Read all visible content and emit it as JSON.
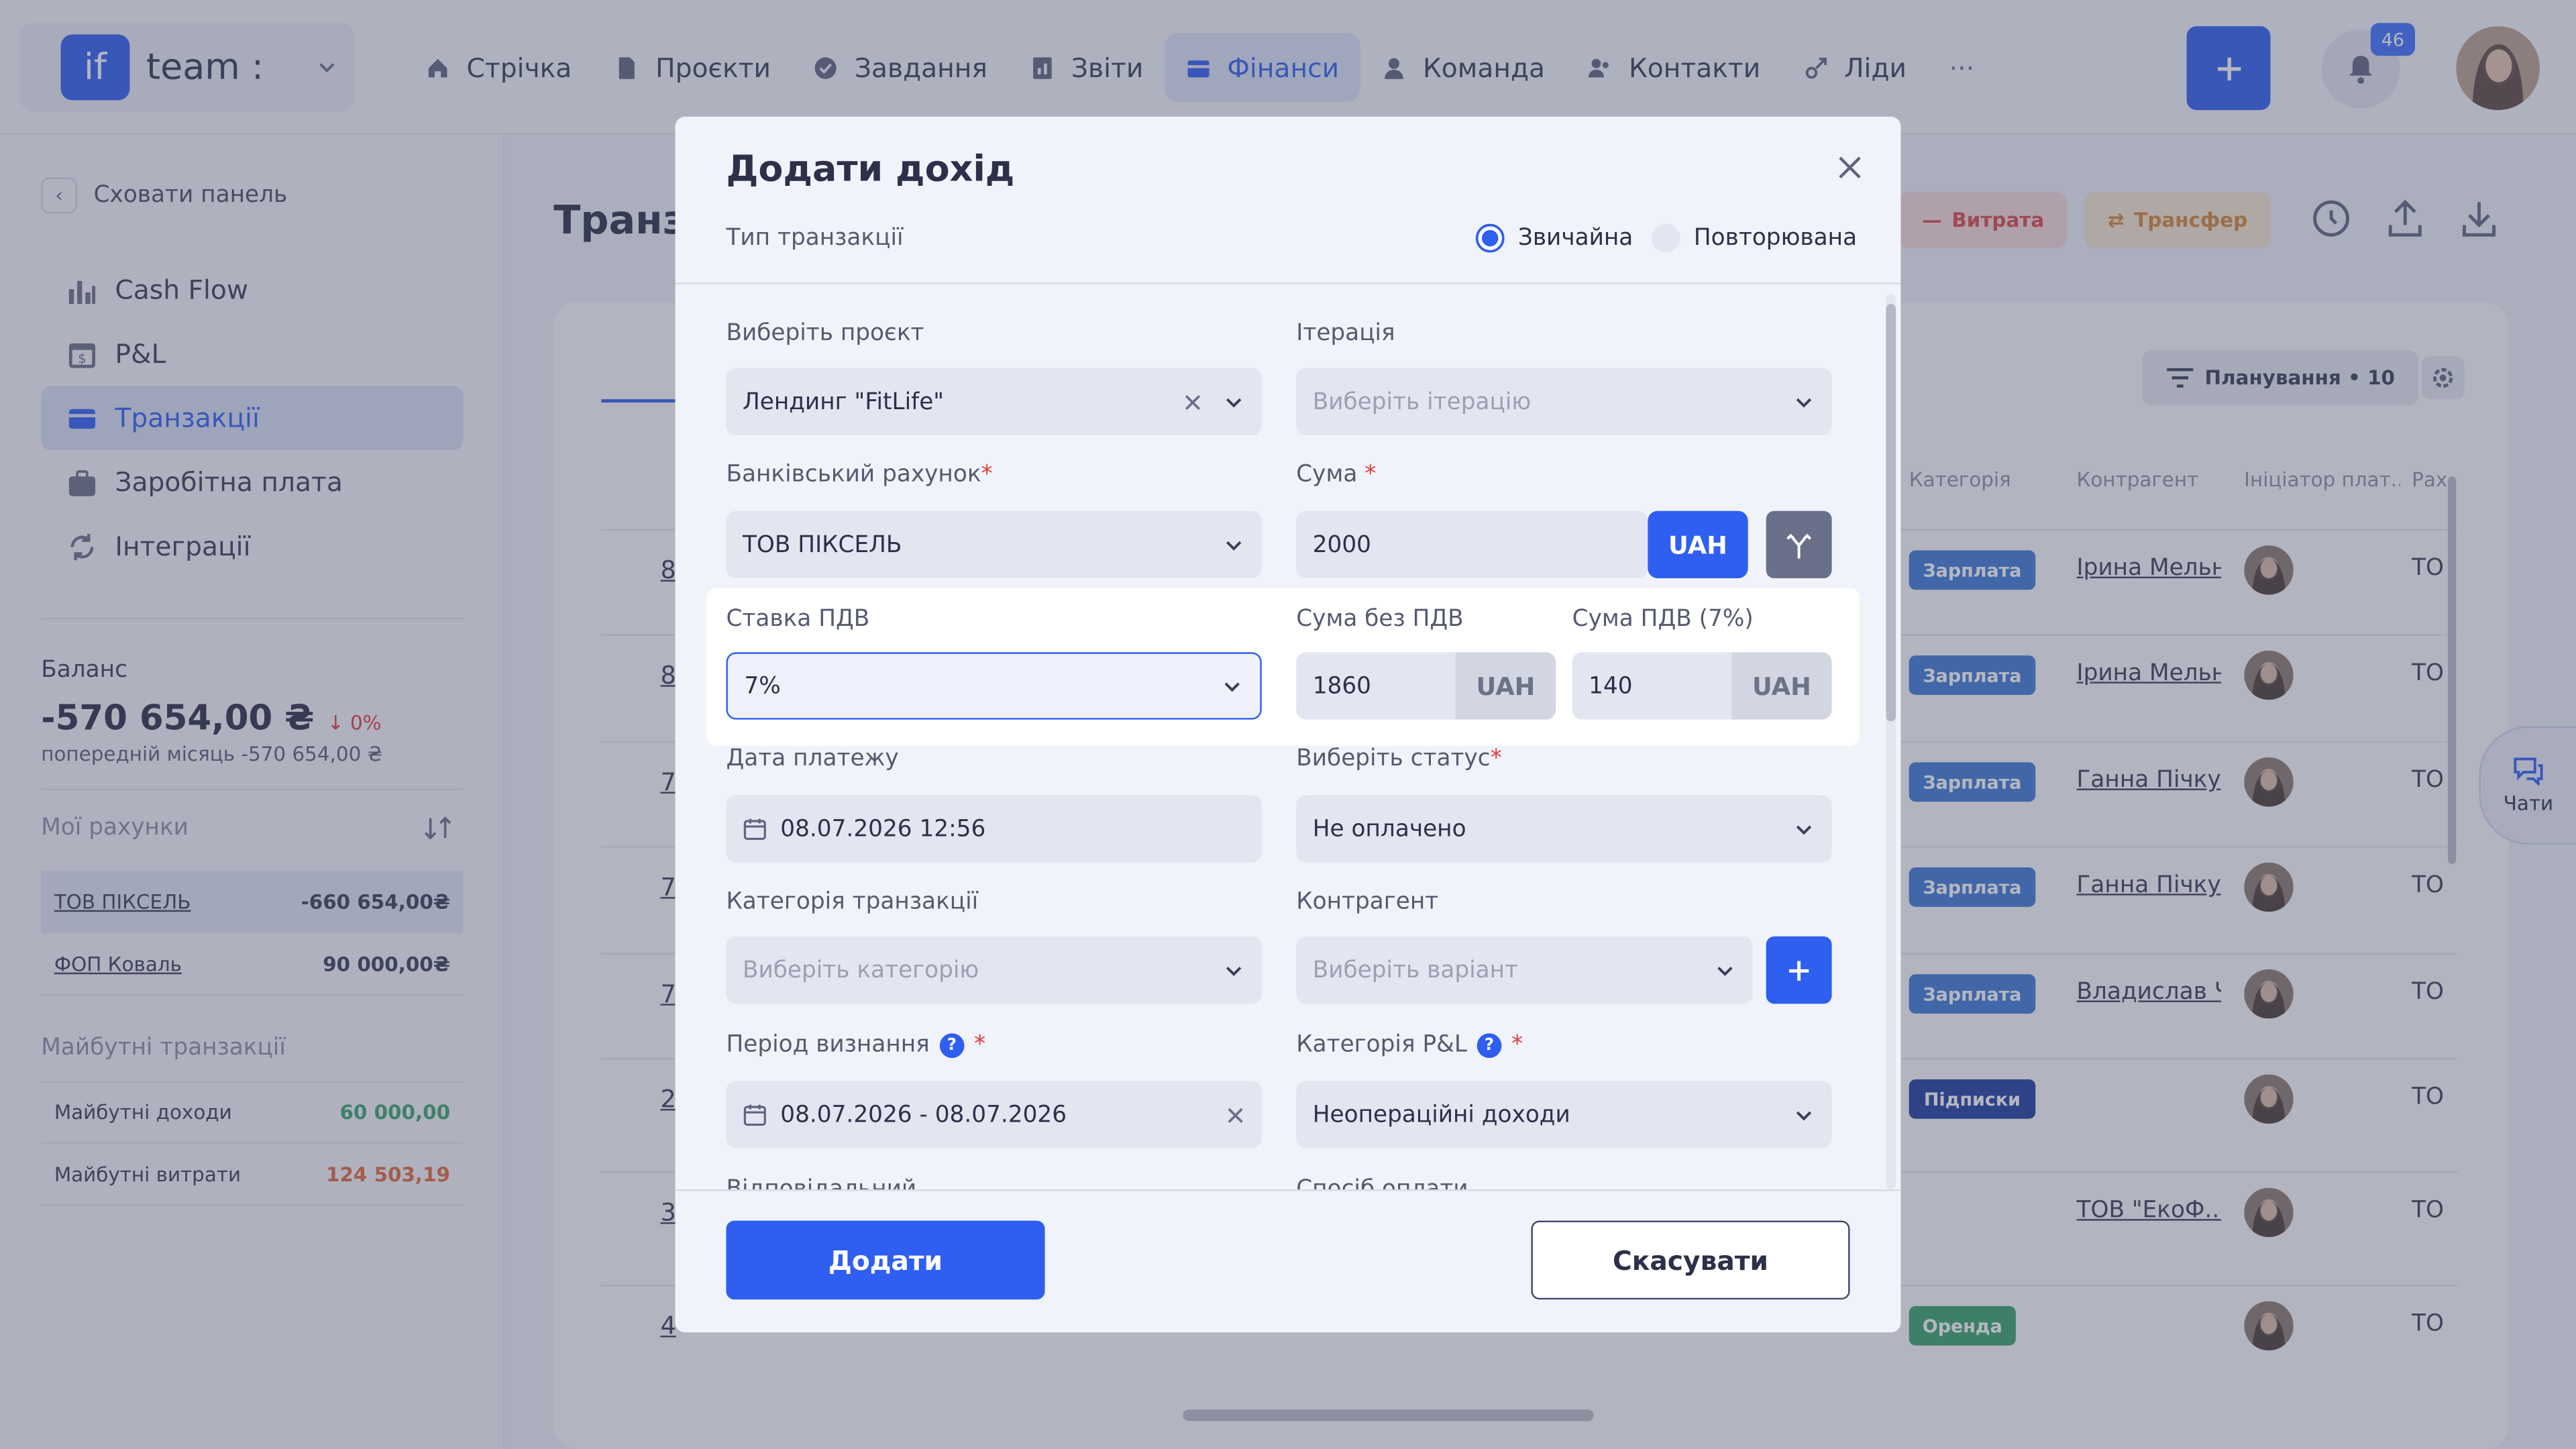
{
  "brand": {
    "logo": "if",
    "name": "team :"
  },
  "nav": [
    {
      "label": "Стрічка",
      "icon": "home-icon"
    },
    {
      "label": "Проєкти",
      "icon": "document-icon"
    },
    {
      "label": "Завдання",
      "icon": "check-circle-icon"
    },
    {
      "label": "Звіти",
      "icon": "report-icon"
    },
    {
      "label": "Фінанси",
      "icon": "wallet-icon"
    },
    {
      "label": "Команда",
      "icon": "user-icon"
    },
    {
      "label": "Контакти",
      "icon": "contacts-icon"
    },
    {
      "label": "Ліди",
      "icon": "leads-icon"
    },
    {
      "label": "···",
      "icon": "more-icon"
    }
  ],
  "notifications": {
    "count": "46"
  },
  "sidebar": {
    "hide_label": "Сховати панель",
    "items": [
      {
        "label": "Cash Flow",
        "icon": "bar-chart-icon"
      },
      {
        "label": "P&L",
        "icon": "calendar-dollar-icon"
      },
      {
        "label": "Транзакції",
        "icon": "card-icon"
      },
      {
        "label": "Заробітна плата",
        "icon": "briefcase-icon"
      },
      {
        "label": "Інтеграції",
        "icon": "sync-icon"
      }
    ],
    "balance_title": "Баланс",
    "balance_value": "-570 654,00 ₴",
    "balance_change": "0%",
    "balance_prev": "попередній місяць -570 654,00 ₴",
    "accounts_title": "Мої рахунки",
    "accounts": [
      {
        "name": "ТОВ ПІКСЕЛЬ",
        "amount": "-660 654,00₴"
      },
      {
        "name": "ФОП Коваль",
        "amount": "90 000,00₴"
      }
    ],
    "future_title": "Майбутні транзакції",
    "future": [
      {
        "name": "Майбутні доходи",
        "amount": "60 000,00"
      },
      {
        "name": "Майбутні витрати",
        "amount": "124 503,19"
      }
    ]
  },
  "page": {
    "title": "Транз",
    "btn_expense": "Витрата",
    "btn_transfer": "Трансфер",
    "planning": "Планування • 10",
    "columns": [
      "Категорія",
      "Контрагент",
      "Ініціатор плат...",
      "Рах"
    ],
    "rows": [
      {
        "id": "8",
        "category": "Зарплата",
        "contractor": "Ірина Мельни",
        "acc": "ТО"
      },
      {
        "id": "8",
        "category": "Зарплата",
        "contractor": "Ірина Мельни",
        "acc": "ТО"
      },
      {
        "id": "7",
        "category": "Зарплата",
        "contractor": "Ганна Пічкур",
        "acc": "ТО"
      },
      {
        "id": "7",
        "category": "Зарплата",
        "contractor": "Ганна Пічкур",
        "acc": "ТО"
      },
      {
        "id": "7",
        "category": "Зарплата",
        "contractor": "Владислав Ч",
        "acc": "ТО"
      },
      {
        "id": "2",
        "category": "Підписки",
        "contractor": "",
        "acc": "ТО"
      },
      {
        "id": "3",
        "category": "",
        "contractor": "ТОВ \"ЕкоФ...",
        "acc": "ТО"
      },
      {
        "id": "4",
        "category": "Оренда",
        "contractor": "",
        "acc": "ТО"
      }
    ],
    "chat_label": "Чати"
  },
  "modal": {
    "title": "Додати дохід",
    "type_label": "Тип транзакції",
    "type_options": [
      "Звичайна",
      "Повторювана"
    ],
    "project_label": "Виберіть проєкт",
    "project_value": "Лендинг \"FitLife\"",
    "iteration_label": "Ітерація",
    "iteration_placeholder": "Виберіть ітерацію",
    "bank_label": "Банківський рахунок",
    "bank_value": "ТОВ ПІКСЕЛЬ",
    "sum_label": "Сума",
    "sum_value": "2000",
    "currency": "UAH",
    "vat_label": "Ставка ПДВ",
    "vat_value": "7%",
    "sum_no_vat_label": "Сума без ПДВ",
    "sum_no_vat_value": "1860",
    "vat_sum_label": "Сума ПДВ (7%)",
    "vat_sum_value": "140",
    "date_label": "Дата платежу",
    "date_value": "08.07.2026 12:56",
    "status_label": "Виберіть статус",
    "status_value": "Не оплачено",
    "category_label": "Категорія транзакції",
    "category_placeholder": "Виберіть категорію",
    "contractor_label": "Контрагент",
    "contractor_placeholder": "Виберіть варіант",
    "period_label": "Період визнання",
    "period_value": "08.07.2026 - 08.07.2026",
    "pl_label": "Категорія P&L",
    "pl_value": "Неопераційні доходи",
    "responsible_label": "Відповідальний",
    "payment_label": "Спосіб оплати",
    "submit": "Додати",
    "cancel": "Скасувати"
  },
  "colors": {
    "accent": "#2f5ff0",
    "danger": "#e03d3d",
    "success": "#3aa36a"
  }
}
